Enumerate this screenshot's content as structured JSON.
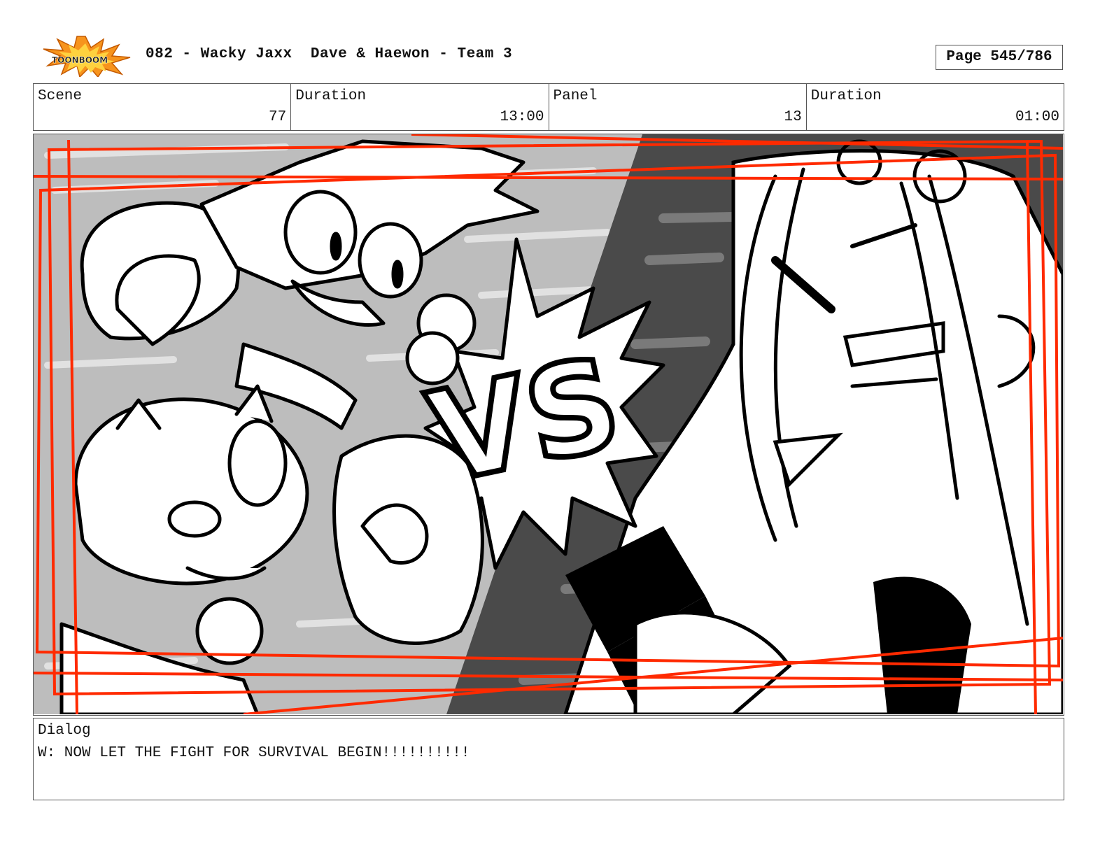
{
  "header": {
    "logo_text": "TOONBOOM",
    "title": "082 - Wacky Jaxx  Dave & Haewon - Team 3",
    "page": "Page 545/786"
  },
  "info": [
    {
      "label": "Scene",
      "value": "77"
    },
    {
      "label": "Duration",
      "value": "13:00"
    },
    {
      "label": "Panel",
      "value": "13"
    },
    {
      "label": "Duration",
      "value": "01:00"
    }
  ],
  "panel": {
    "vs_text": "VS",
    "frame_color": "#ff2a00"
  },
  "dialog": {
    "label": "Dialog",
    "text": "W: NOW LET THE FIGHT FOR SURVIVAL BEGIN!!!!!!!!!!"
  },
  "colors": {
    "logo_orange": "#f7941d",
    "logo_dark": "#1a1a1a",
    "border": "#555555"
  }
}
